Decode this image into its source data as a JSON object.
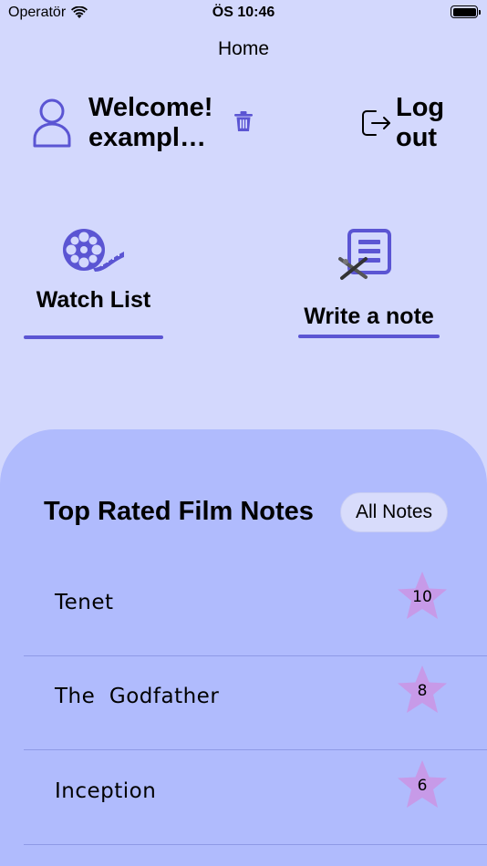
{
  "status_bar": {
    "carrier": "Operatör",
    "time": "ÖS 10:46"
  },
  "nav": {
    "title": "Home"
  },
  "header": {
    "welcome_line1": "Welcome!",
    "welcome_line2": "exampl…",
    "logout_line1": "Log",
    "logout_line2": "out"
  },
  "tiles": {
    "watch_list": "Watch List",
    "write_note": "Write a note"
  },
  "top_rated": {
    "title": "Top Rated Film Notes",
    "all_notes_label": "All Notes",
    "notes": [
      {
        "title": "Tenet",
        "rating": "10"
      },
      {
        "title": "The  Godfather",
        "rating": "8"
      },
      {
        "title": "Inception",
        "rating": "6"
      }
    ]
  },
  "colors": {
    "background": "#d3d8fd",
    "panel": "#b0bbfd",
    "accent": "#5b55d3",
    "star": "#c79ae8"
  }
}
